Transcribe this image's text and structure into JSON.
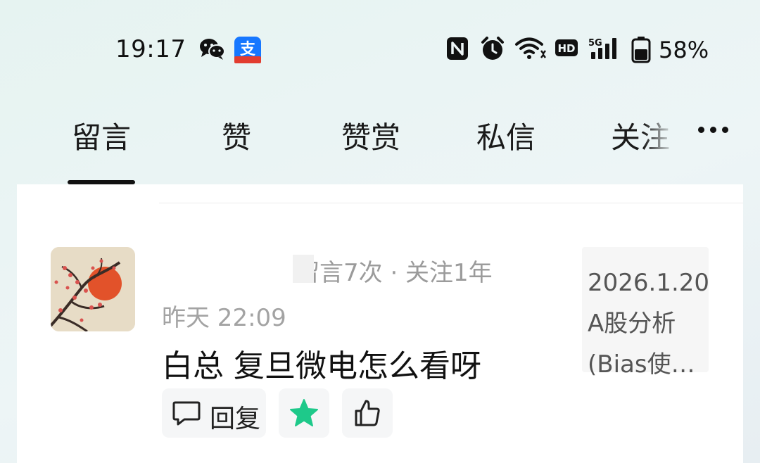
{
  "status_bar": {
    "time": "19:17",
    "notification_icons": [
      "wechat-icon",
      "alipay-icon"
    ],
    "system_icons": [
      "nfc-icon",
      "alarm-icon",
      "wifi-icon",
      "hd-icon",
      "signal-5g-icon",
      "battery-icon"
    ],
    "battery_percent": "58%",
    "signal_label": "5G",
    "hd_label": "HD"
  },
  "tabs": [
    {
      "label": "留言",
      "active": true
    },
    {
      "label": "赞",
      "active": false
    },
    {
      "label": "赞赏",
      "active": false
    },
    {
      "label": "私信",
      "active": false
    },
    {
      "label": "关注",
      "active": false
    }
  ],
  "more_icon": "more-horizontal-icon",
  "comment": {
    "username": "",
    "stats": "留言7次 · 关注1年",
    "time": "昨天 22:09",
    "text": "白总 复旦微电怎么看呀",
    "reply_label": "回复",
    "article_lines": [
      "2026.1.20",
      "A股分析",
      "(Bias使…"
    ]
  },
  "colors": {
    "accent_green": "#1ec98a",
    "text_primary": "#111111",
    "text_secondary": "#9b9b9b"
  }
}
